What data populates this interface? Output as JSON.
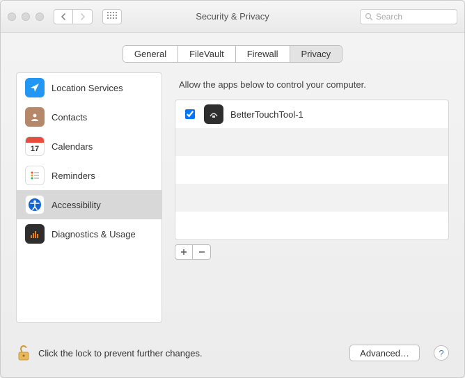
{
  "window": {
    "title": "Security & Privacy"
  },
  "search": {
    "placeholder": "Search"
  },
  "tabs": [
    {
      "label": "General"
    },
    {
      "label": "FileVault"
    },
    {
      "label": "Firewall"
    },
    {
      "label": "Privacy",
      "active": true
    }
  ],
  "sidebar": {
    "items": [
      {
        "label": "Location Services",
        "icon": "location",
        "color": "#1E90FF"
      },
      {
        "label": "Contacts",
        "icon": "contacts",
        "color": "#B5886A"
      },
      {
        "label": "Calendars",
        "icon": "calendar",
        "color": "#FFFFFF"
      },
      {
        "label": "Reminders",
        "icon": "reminders",
        "color": "#FFFFFF"
      },
      {
        "label": "Accessibility",
        "icon": "accessibility",
        "color": "#1164D6",
        "selected": true
      },
      {
        "label": "Diagnostics & Usage",
        "icon": "diagnostics",
        "color": "#2E2E2E"
      }
    ]
  },
  "main": {
    "hint": "Allow the apps below to control your computer.",
    "apps": [
      {
        "name": "BetterTouchTool-1",
        "checked": true
      }
    ]
  },
  "footer": {
    "lock_text": "Click the lock to prevent further changes.",
    "advanced_label": "Advanced…"
  },
  "calendar_day": "17"
}
